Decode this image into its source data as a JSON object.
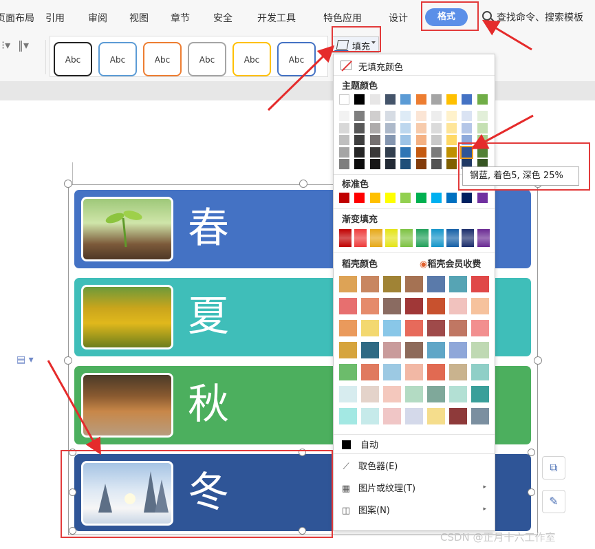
{
  "ribbon": {
    "tabs": [
      "页面布局",
      "引用",
      "审阅",
      "视图",
      "章节",
      "安全",
      "开发工具",
      "特色应用",
      "设计"
    ],
    "active_tab": "格式",
    "search_label": "查找命令、搜索模板"
  },
  "toolbar": {
    "shape_styles": [
      "Abc",
      "Abc",
      "Abc",
      "Abc",
      "Abc",
      "Abc"
    ],
    "fill_label": "填充"
  },
  "canvas": {
    "cards": [
      {
        "label": "春",
        "color": "#4472c4"
      },
      {
        "label": "夏",
        "color": "#3fbeb9"
      },
      {
        "label": "秋",
        "color": "#4caf5e"
      },
      {
        "label": "冬",
        "color": "#2f5597"
      }
    ]
  },
  "fill_menu": {
    "no_fill": "无填充颜色",
    "theme_colors_title": "主题颜色",
    "standard_colors_title": "标准色",
    "gradient_title": "渐变填充",
    "daoke_title": "稻壳颜色",
    "member_link": "稻壳会员收费",
    "auto_label": "自动",
    "eyedropper": "取色器(E)",
    "picture_texture": "图片或纹理(T)",
    "pattern": "图案(N)",
    "theme_top_row": [
      "#ffffff",
      "#000000",
      "#e7e6e6",
      "#44546a",
      "#5b9bd5",
      "#ed7d31",
      "#a5a5a5",
      "#ffc000",
      "#4472c4",
      "#70ad47"
    ],
    "theme_shades": [
      [
        "#f2f2f2",
        "#7f7f7f",
        "#d0cece",
        "#d6dce4",
        "#deebf6",
        "#fbe5d5",
        "#ededed",
        "#fff2cc",
        "#dae3f3",
        "#e2efd9"
      ],
      [
        "#d8d8d8",
        "#595959",
        "#aeabab",
        "#adb9ca",
        "#bdd7ee",
        "#f7cbac",
        "#dbdbdb",
        "#fee599",
        "#b4c6e7",
        "#c5e0b3"
      ],
      [
        "#bfbfbf",
        "#3f3f3f",
        "#757070",
        "#8496b0",
        "#9dc3e6",
        "#f4b183",
        "#c9c9c9",
        "#ffd966",
        "#8eaadb",
        "#a8d08d"
      ],
      [
        "#a5a5a5",
        "#262626",
        "#3a3838",
        "#323f4f",
        "#2e75b5",
        "#c55a11",
        "#7b7b7b",
        "#bf9000",
        "#2f5597",
        "#538135"
      ],
      [
        "#7f7f7f",
        "#0c0c0c",
        "#171616",
        "#222a35",
        "#1e4e79",
        "#833c0b",
        "#525252",
        "#7f6000",
        "#1f3864",
        "#375623"
      ]
    ],
    "standard_colors": [
      "#c00000",
      "#ff0000",
      "#ffc000",
      "#ffff00",
      "#92d050",
      "#00b050",
      "#00b0f0",
      "#0070c0",
      "#002060",
      "#7030a0"
    ],
    "gradient_colors": [
      "#c00000",
      "#ee3b3b",
      "#e6a817",
      "#e4e416",
      "#7dc242",
      "#21a05a",
      "#1495c9",
      "#155fa6",
      "#1b2d6b",
      "#6a2a93"
    ],
    "daoke_colors": [
      [
        "#dda356",
        "#c88660",
        "#a08335",
        "#a57253",
        "#5a7aaa",
        "#56a4b4",
        "#e04848"
      ],
      [
        "#e76f6f",
        "#e58b6b",
        "#8a6b61",
        "#a03737",
        "#c8512e",
        "#f1c2be",
        "#f6c29d"
      ],
      [
        "#ea9a5c",
        "#f3d870",
        "#89c7e8",
        "#e76a5b",
        "#9f4a4a",
        "#c07763",
        "#f28f8f"
      ],
      [
        "#d6a43c",
        "#2f6a84",
        "#c99b9b",
        "#8d6a5a",
        "#60a6c7",
        "#8fa7d9",
        "#bfd9b3"
      ],
      [
        "#6cbc6b",
        "#e07a5f",
        "#9cc9e3",
        "#f2b8a5",
        "#e16a52",
        "#c9b38e",
        "#8fcfc7"
      ],
      [
        "#d7ecef",
        "#e4d3ca",
        "#f4c8bd",
        "#b3dbc3",
        "#7fa89a",
        "#b3e0d4",
        "#3a9f9a"
      ],
      [
        "#a3e8e3",
        "#c6eaea",
        "#f0c6c6",
        "#d4d9ea",
        "#f5dd8c",
        "#8e3a3a",
        "#7b8fa0"
      ]
    ],
    "tooltip": "钢蓝, 着色5, 深色 25%"
  },
  "watermark": "CSDN @正月十六工作室"
}
